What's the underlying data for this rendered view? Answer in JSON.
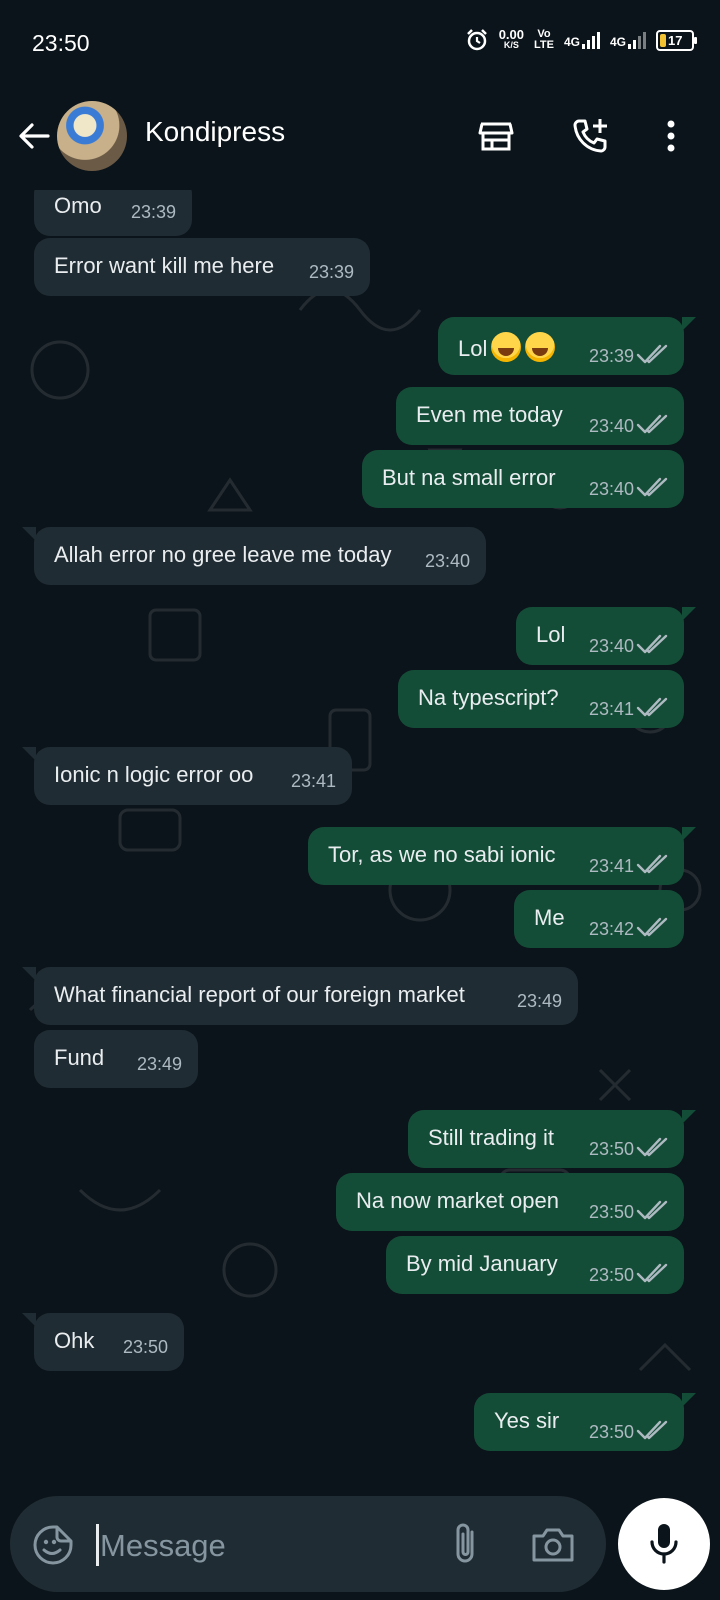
{
  "status_bar": {
    "time": "23:50",
    "net_speed": "0.00",
    "net_unit": "K/S",
    "volte_top": "Vo",
    "volte_bottom": "LTE",
    "signal1": "4G",
    "signal2": "4G",
    "battery": "17"
  },
  "header": {
    "contact_name": "Kondipress",
    "icons": [
      "back-arrow-icon",
      "shop-icon",
      "add-call-icon",
      "more-vert-icon"
    ]
  },
  "messages": [
    {
      "dir": "in",
      "text": "Omo",
      "time": "23:39"
    },
    {
      "dir": "in",
      "text": "Error want kill me here",
      "time": "23:39"
    },
    {
      "dir": "out",
      "text": "Lol",
      "emoji": "😂😂",
      "time": "23:39",
      "status": "read"
    },
    {
      "dir": "out",
      "text": "Even me today",
      "time": "23:40",
      "status": "read"
    },
    {
      "dir": "out",
      "text": "But na small error",
      "time": "23:40",
      "status": "read"
    },
    {
      "dir": "in",
      "text": "Allah error no gree leave me today",
      "time": "23:40"
    },
    {
      "dir": "out",
      "text": "Lol",
      "time": "23:40",
      "status": "read"
    },
    {
      "dir": "out",
      "text": "Na typescript?",
      "time": "23:41",
      "status": "read"
    },
    {
      "dir": "in",
      "text": "Ionic n logic error oo",
      "time": "23:41"
    },
    {
      "dir": "out",
      "text": "Tor, as we no sabi ionic",
      "time": "23:41",
      "status": "read"
    },
    {
      "dir": "out",
      "text": "Me",
      "time": "23:42",
      "status": "read"
    },
    {
      "dir": "in",
      "text": "What financial report of our foreign market",
      "time": "23:49"
    },
    {
      "dir": "in",
      "text": "Fund",
      "time": "23:49"
    },
    {
      "dir": "out",
      "text": "Still trading it",
      "time": "23:50",
      "status": "read"
    },
    {
      "dir": "out",
      "text": "Na now market open",
      "time": "23:50",
      "status": "read"
    },
    {
      "dir": "out",
      "text": "By mid January",
      "time": "23:50",
      "status": "read"
    },
    {
      "dir": "in",
      "text": "Ohk",
      "time": "23:50"
    },
    {
      "dir": "out",
      "text": "Yes sir",
      "time": "23:50",
      "status": "read"
    }
  ],
  "composer": {
    "placeholder": "Message",
    "icons": [
      "sticker-icon",
      "attach-icon",
      "camera-icon",
      "mic-icon"
    ]
  },
  "colors": {
    "background": "#0b141a",
    "incoming_bubble": "#202c33",
    "outgoing_bubble": "#144d37",
    "read_ticks": "#aebac1"
  }
}
